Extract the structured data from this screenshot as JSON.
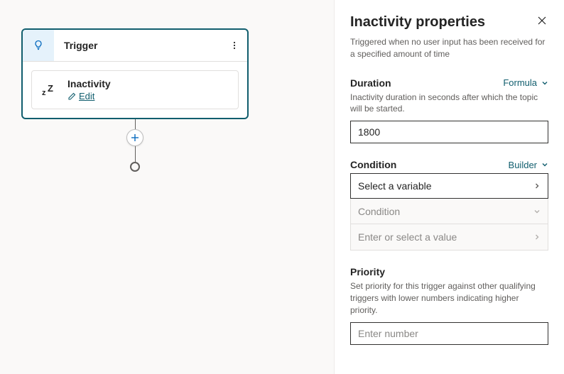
{
  "canvas": {
    "trigger": {
      "title": "Trigger",
      "inner_title": "Inactivity",
      "edit_label": "Edit"
    }
  },
  "panel": {
    "title": "Inactivity properties",
    "description": "Triggered when no user input has been received for a specified amount of time",
    "duration": {
      "label": "Duration",
      "mode": "Formula",
      "help": "Inactivity duration in seconds after which the topic will be started.",
      "value": "1800"
    },
    "condition": {
      "label": "Condition",
      "mode": "Builder",
      "select_placeholder": "Select a variable",
      "condition_placeholder": "Condition",
      "value_placeholder": "Enter or select a value"
    },
    "priority": {
      "label": "Priority",
      "help": "Set priority for this trigger against other qualifying triggers with lower numbers indicating higher priority.",
      "placeholder": "Enter number"
    }
  }
}
